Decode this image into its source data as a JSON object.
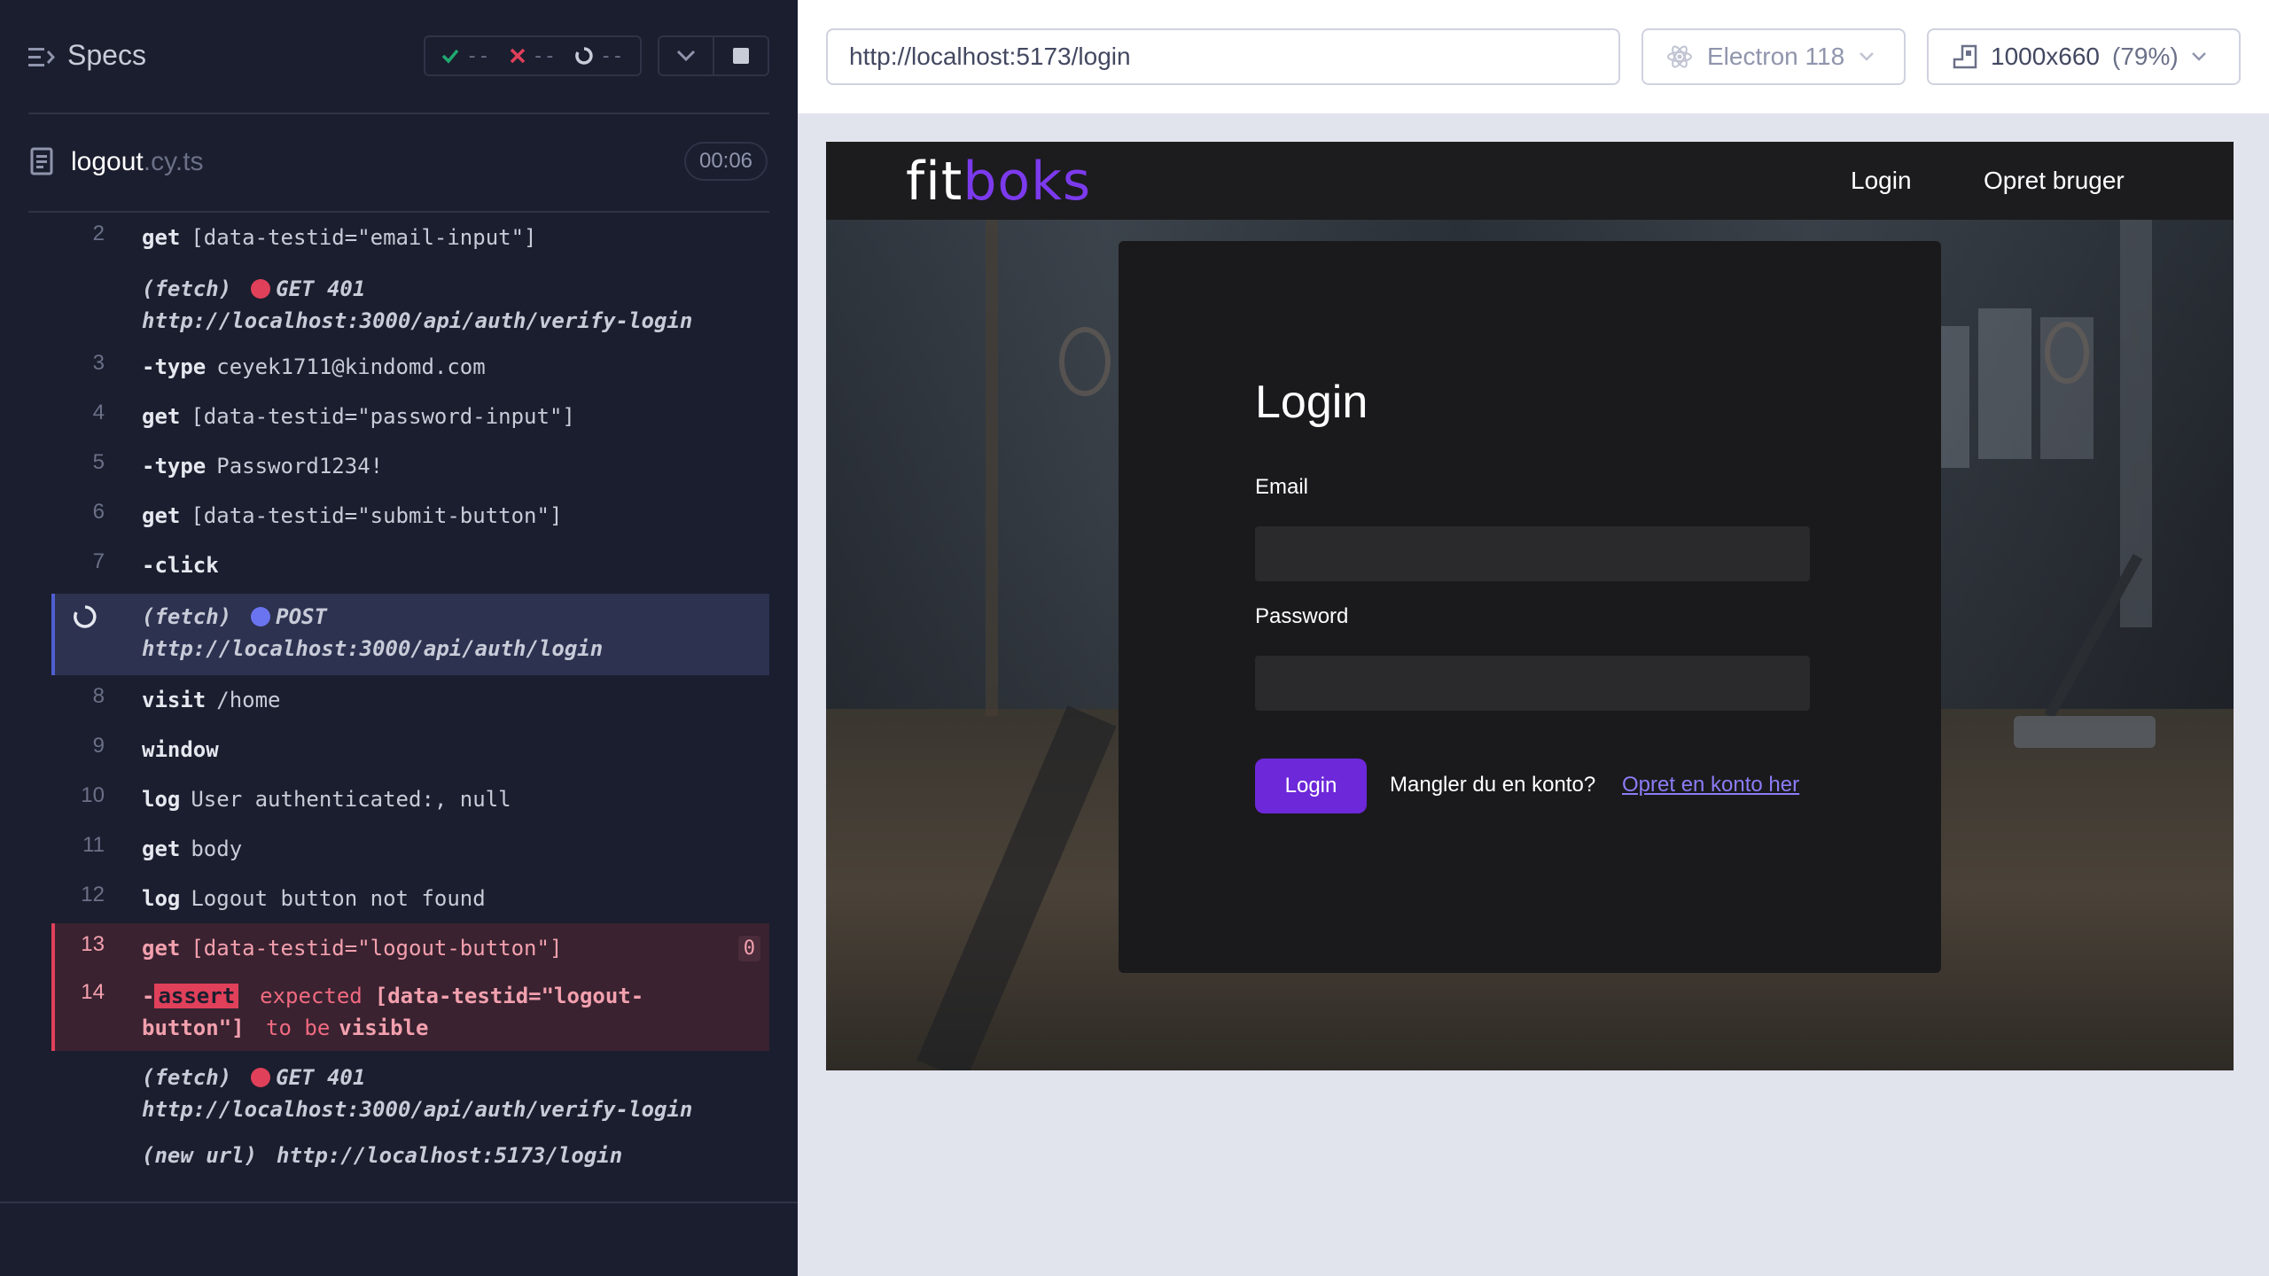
{
  "runner": {
    "specs_title": "Specs",
    "stats": {
      "passed": "--",
      "failed": "--",
      "pending": "--"
    },
    "file": {
      "name": "logout",
      "ext": ".cy.ts"
    },
    "timer": "00:06",
    "commands": [
      {
        "num": "2",
        "kw": "get",
        "arg": "[data-testid=\"email-input\"]"
      },
      {
        "fetch": "(fetch)",
        "method": "GET 401",
        "url": "http://localhost:3000/api/auth/verify-login"
      },
      {
        "num": "3",
        "kw": "-type",
        "arg": "ceyek1711@kindomd.com"
      },
      {
        "num": "4",
        "kw": "get",
        "arg": "[data-testid=\"password-input\"]"
      },
      {
        "num": "5",
        "kw": "-type",
        "arg": "Password1234!"
      },
      {
        "num": "6",
        "kw": "get",
        "arg": "[data-testid=\"submit-button\"]"
      },
      {
        "num": "7",
        "kw": "-click",
        "arg": ""
      },
      {
        "fetch": "(fetch)",
        "method": "POST",
        "url": "http://localhost:3000/api/auth/login"
      },
      {
        "num": "8",
        "kw": "visit",
        "arg": "/home"
      },
      {
        "num": "9",
        "kw": "window",
        "arg": ""
      },
      {
        "num": "10",
        "kw": "log",
        "arg": "User authenticated:, null"
      },
      {
        "num": "11",
        "kw": "get",
        "arg": "body"
      },
      {
        "num": "12",
        "kw": "log",
        "arg": "Logout button not found"
      },
      {
        "num": "13",
        "kw": "get",
        "arg": "[data-testid=\"logout-button\"]",
        "badge": "0"
      },
      {
        "num": "14",
        "assert": "assert",
        "expected": "expected",
        "subject1": "[data-testid=\"logout-",
        "subject2": "button\"]",
        "tobe": "to be",
        "visible": "visible"
      },
      {
        "fetch": "(fetch)",
        "method": "GET 401",
        "url": "http://localhost:3000/api/auth/verify-login"
      },
      {
        "newurl": "(new url)",
        "url": "http://localhost:5173/login"
      }
    ]
  },
  "browser": {
    "url": "http://localhost:5173/login",
    "name": "Electron 118",
    "viewport": "1000x660",
    "zoom": "(79%)"
  },
  "app": {
    "logo_a": "fit",
    "logo_b": "boks",
    "nav_login": "Login",
    "nav_signup": "Opret bruger",
    "title": "Login",
    "email_label": "Email",
    "password_label": "Password",
    "login_button": "Login",
    "no_account": "Mangler du en konto?",
    "create_link": "Opret en konto her"
  },
  "colors": {
    "runner_bg": "#1b1e2e",
    "accent": "#6d28d9",
    "error_row": "#3a2230",
    "pending_row": "#2c3250",
    "fail_dot": "#e0405a",
    "pending_dot": "#6b74f0"
  }
}
